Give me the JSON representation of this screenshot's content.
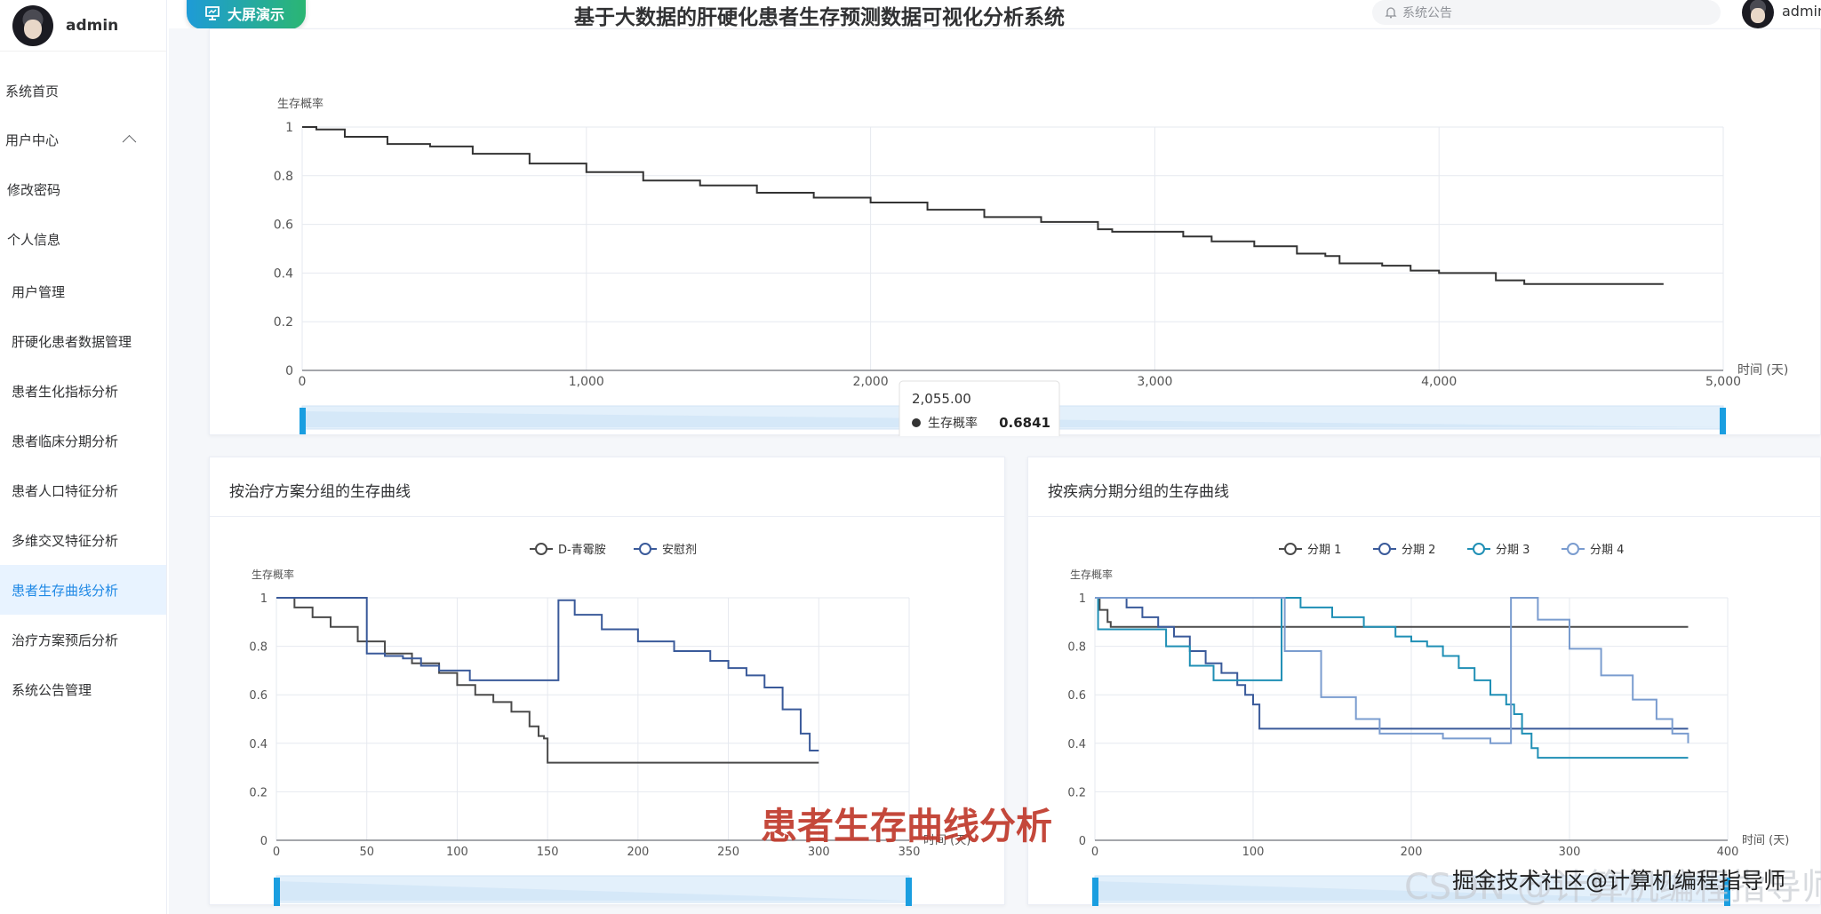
{
  "app": {
    "title": "基于大数据的肝硬化患者生存预测数据可视化分析系统",
    "big_screen_label": "大屏演示"
  },
  "header": {
    "notice_placeholder": "系统公告",
    "user": "admin"
  },
  "sidebar": {
    "user": "admin",
    "items": [
      {
        "label": "系统首页",
        "active": false
      },
      {
        "label": "用户中心",
        "active": false,
        "expanded": true
      },
      {
        "label": "修改密码",
        "active": false
      },
      {
        "label": "个人信息",
        "active": false
      },
      {
        "label": "用户管理",
        "active": false
      },
      {
        "label": "肝硬化患者数据管理",
        "active": false
      },
      {
        "label": "患者生化指标分析",
        "active": false
      },
      {
        "label": "患者临床分期分析",
        "active": false
      },
      {
        "label": "患者人口特征分析",
        "active": false
      },
      {
        "label": "多维交叉特征分析",
        "active": false
      },
      {
        "label": "患者生存曲线分析",
        "active": true
      },
      {
        "label": "治疗方案预后分析",
        "active": false
      },
      {
        "label": "系统公告管理",
        "active": false
      }
    ]
  },
  "overlay": {
    "page_caption": "患者生存曲线分析",
    "watermark_gray": "CSDN @计算机编程指导师",
    "watermark_dark": "掘金技术社区@计算机编程指导师"
  },
  "chart_data": [
    {
      "type": "line",
      "title": "",
      "ylabel": "生存概率",
      "xlabel": "时间 (天)",
      "xlim": [
        0,
        5000
      ],
      "ylim": [
        0,
        1
      ],
      "x_ticks": [
        "0",
        "1,000",
        "2,000",
        "3,000",
        "4,000",
        "5,000"
      ],
      "y_ticks": [
        "0",
        "0.2",
        "0.4",
        "0.6",
        "0.8",
        "1"
      ],
      "grid": true,
      "series": [
        {
          "color": "#333333",
          "x": [
            0,
            50,
            150,
            300,
            450,
            600,
            800,
            1000,
            1200,
            1400,
            1600,
            1800,
            2000,
            2200,
            2400,
            2600,
            2800,
            2850,
            3000,
            3100,
            3200,
            3350,
            3500,
            3600,
            3650,
            3800,
            3900,
            4000,
            4200,
            4300,
            4500,
            4790
          ],
          "y": [
            1,
            0.99,
            0.96,
            0.93,
            0.92,
            0.89,
            0.85,
            0.815,
            0.78,
            0.76,
            0.73,
            0.71,
            0.69,
            0.66,
            0.63,
            0.61,
            0.58,
            0.57,
            0.57,
            0.55,
            0.53,
            0.51,
            0.48,
            0.47,
            0.44,
            0.43,
            0.41,
            0.4,
            0.37,
            0.355,
            0.355,
            0.355
          ]
        }
      ],
      "tooltip": {
        "x_label": "2,055.00",
        "series_label": "生存概率",
        "value": "0.6841"
      },
      "data_zoom": {
        "start": 0,
        "end": 100
      }
    },
    {
      "type": "line",
      "title": "按治疗方案分组的生存曲线",
      "ylabel": "生存概率",
      "xlabel": "时间 (天)",
      "xlim": [
        0,
        350
      ],
      "ylim": [
        0,
        1
      ],
      "x_ticks": [
        "0",
        "50",
        "100",
        "150",
        "200",
        "250",
        "300",
        "350"
      ],
      "y_ticks": [
        "0",
        "0.2",
        "0.4",
        "0.6",
        "0.8",
        "1"
      ],
      "legend_position": "top-center",
      "grid": true,
      "series": [
        {
          "name": "D-青霉胺",
          "color": "#4a4a4a",
          "x": [
            0,
            10,
            20,
            30,
            45,
            60,
            75,
            90,
            100,
            110,
            120,
            130,
            140,
            145,
            148,
            150,
            155,
            300
          ],
          "y": [
            1,
            0.96,
            0.92,
            0.88,
            0.82,
            0.77,
            0.73,
            0.69,
            0.64,
            0.6,
            0.57,
            0.53,
            0.47,
            0.43,
            0.42,
            0.32,
            0.32,
            0.32
          ]
        },
        {
          "name": "安慰剂",
          "color": "#3a5a9a",
          "x": [
            0,
            49,
            50,
            60,
            70,
            80,
            90,
            100,
            107,
            150,
            156,
            165,
            180,
            200,
            220,
            240,
            250,
            260,
            270,
            280,
            290,
            295,
            300
          ],
          "y": [
            1,
            1,
            0.77,
            0.76,
            0.75,
            0.72,
            0.7,
            0.7,
            0.66,
            0.66,
            0.99,
            0.93,
            0.87,
            0.82,
            0.78,
            0.74,
            0.71,
            0.68,
            0.63,
            0.54,
            0.44,
            0.37,
            0.37
          ]
        }
      ],
      "data_zoom": {
        "start": 0,
        "end": 100
      }
    },
    {
      "type": "line",
      "title": "按疾病分期分组的生存曲线",
      "ylabel": "生存概率",
      "xlabel": "时间 (天)",
      "xlim": [
        0,
        400
      ],
      "ylim": [
        0,
        1
      ],
      "x_ticks": [
        "0",
        "100",
        "200",
        "300",
        "400"
      ],
      "y_ticks": [
        "0",
        "0.2",
        "0.4",
        "0.6",
        "0.8",
        "1"
      ],
      "legend_position": "top-center",
      "grid": true,
      "series": [
        {
          "name": "分期 1",
          "color": "#4a4a4a",
          "x": [
            0,
            3,
            8,
            10,
            375
          ],
          "y": [
            1,
            0.95,
            0.9,
            0.88,
            0.88
          ]
        },
        {
          "name": "分期 2",
          "color": "#3a5a9a",
          "x": [
            0,
            20,
            30,
            40,
            50,
            60,
            70,
            80,
            90,
            95,
            100,
            104,
            108,
            375
          ],
          "y": [
            1,
            0.96,
            0.92,
            0.88,
            0.84,
            0.78,
            0.73,
            0.69,
            0.64,
            0.6,
            0.56,
            0.46,
            0.46,
            0.46
          ]
        },
        {
          "name": "分期 3",
          "color": "#1f8fb5",
          "x": [
            0,
            2,
            30,
            45,
            60,
            75,
            95,
            116,
            118,
            130,
            150,
            170,
            190,
            200,
            210,
            220,
            230,
            240,
            250,
            260,
            265,
            270,
            276,
            280,
            375
          ],
          "y": [
            1,
            0.87,
            0.87,
            0.8,
            0.72,
            0.66,
            0.66,
            0.66,
            1.0,
            0.96,
            0.92,
            0.88,
            0.84,
            0.82,
            0.8,
            0.76,
            0.71,
            0.66,
            0.6,
            0.56,
            0.52,
            0.44,
            0.38,
            0.34,
            0.34
          ]
        },
        {
          "name": "分期 4",
          "color": "#7a9ccf",
          "x": [
            0,
            115,
            120,
            140,
            143,
            165,
            180,
            220,
            250,
            262,
            263,
            280,
            300,
            320,
            340,
            355,
            365,
            375
          ],
          "y": [
            1,
            1.0,
            0.78,
            0.78,
            0.59,
            0.5,
            0.44,
            0.42,
            0.4,
            0.4,
            1.0,
            0.91,
            0.79,
            0.68,
            0.58,
            0.5,
            0.44,
            0.4
          ]
        }
      ],
      "data_zoom": {
        "start": 0,
        "end": 100
      }
    }
  ]
}
